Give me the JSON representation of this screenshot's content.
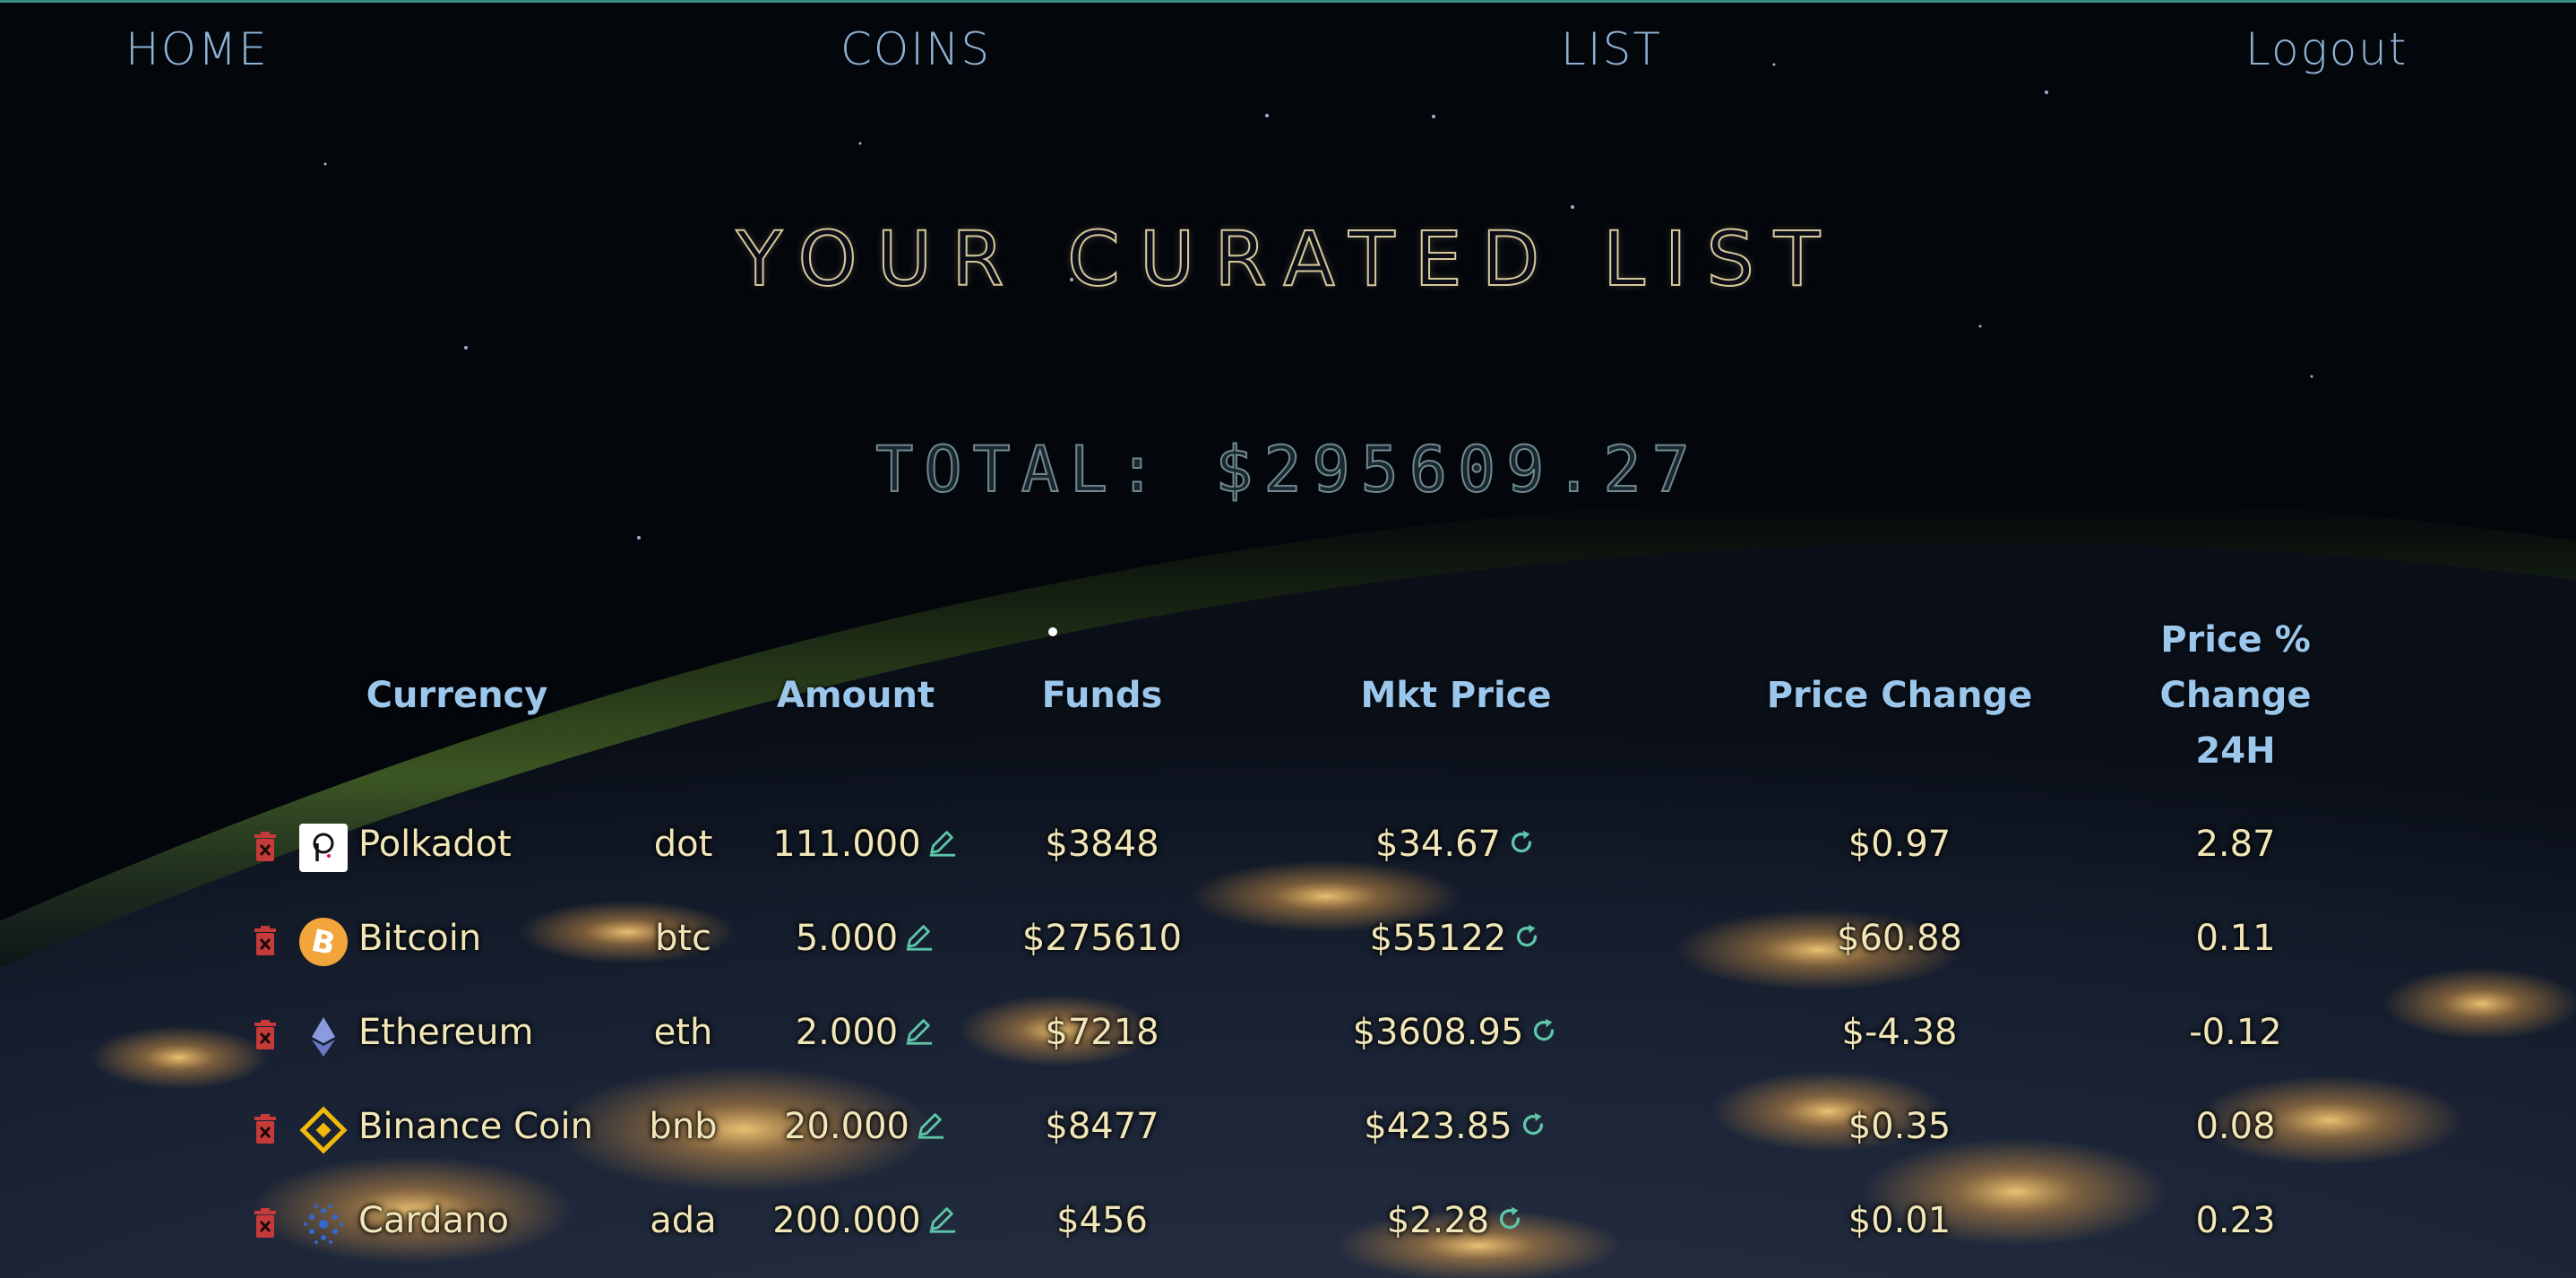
{
  "nav": {
    "home": "HOME",
    "coins": "COINS",
    "list": "LIST",
    "logout": "Logout"
  },
  "page_title": "YOUR CURATED LIST",
  "total_label": "TOTAL: $295609.27",
  "table": {
    "headers": {
      "currency": "Currency",
      "amount": "Amount",
      "funds": "Funds",
      "mkt_price": "Mkt Price",
      "price_change": "Price Change",
      "pct_line1": "Price %",
      "pct_line2": "Change",
      "pct_line3": "24H"
    },
    "rows": [
      {
        "name": "Polkadot",
        "symbol": "dot",
        "amount": "111.000",
        "funds": "$3848",
        "price": "$34.67",
        "change": "$0.97",
        "pct": "2.87",
        "logo": "polkadot-logo"
      },
      {
        "name": "Bitcoin",
        "symbol": "btc",
        "amount": "5.000",
        "funds": "$275610",
        "price": "$55122",
        "change": "$60.88",
        "pct": "0.11",
        "logo": "bitcoin-logo"
      },
      {
        "name": "Ethereum",
        "symbol": "eth",
        "amount": "2.000",
        "funds": "$7218",
        "price": "$3608.95",
        "change": "$-4.38",
        "pct": "-0.12",
        "logo": "ethereum-logo"
      },
      {
        "name": "Binance Coin",
        "symbol": "bnb",
        "amount": "20.000",
        "funds": "$8477",
        "price": "$423.85",
        "change": "$0.35",
        "pct": "0.08",
        "logo": "binance-logo"
      },
      {
        "name": "Cardano",
        "symbol": "ada",
        "amount": "200.000",
        "funds": "$456",
        "price": "$2.28",
        "change": "$0.01",
        "pct": "0.23",
        "logo": "cardano-logo"
      }
    ]
  },
  "colors": {
    "nav_text": "#8fb3d6",
    "header_text": "#9cc7ec",
    "cell_text": "#f1e6b8",
    "trash": "#c63a3a",
    "edit_icon": "#5ec6a8",
    "bitcoin": "#f2a53a",
    "binance": "#f0b90b",
    "ethereum": "#8b9be0",
    "cardano": "#3468d1"
  }
}
